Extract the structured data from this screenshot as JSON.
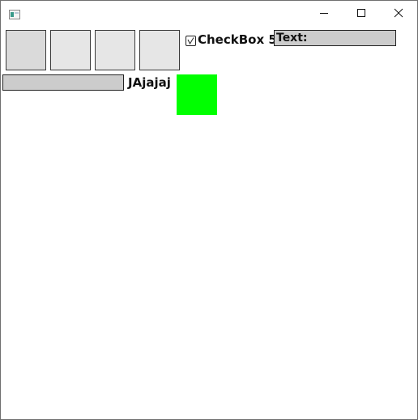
{
  "window": {
    "controls": {
      "minimize_icon": "minimize-icon",
      "maximize_icon": "maximize-icon",
      "close_icon": "close-icon"
    }
  },
  "content": {
    "checkbox": {
      "label": "CheckBox 5",
      "checked": false
    },
    "text_field_1": {
      "value": "Text:"
    },
    "text_field_2": {
      "value": ""
    },
    "label": "JAjajaj",
    "colors": {
      "square_fill": "#e6e6e6",
      "square_fill_first": "#dadada",
      "field_fill": "#cccccc",
      "green_panel": "#00ff00"
    }
  }
}
